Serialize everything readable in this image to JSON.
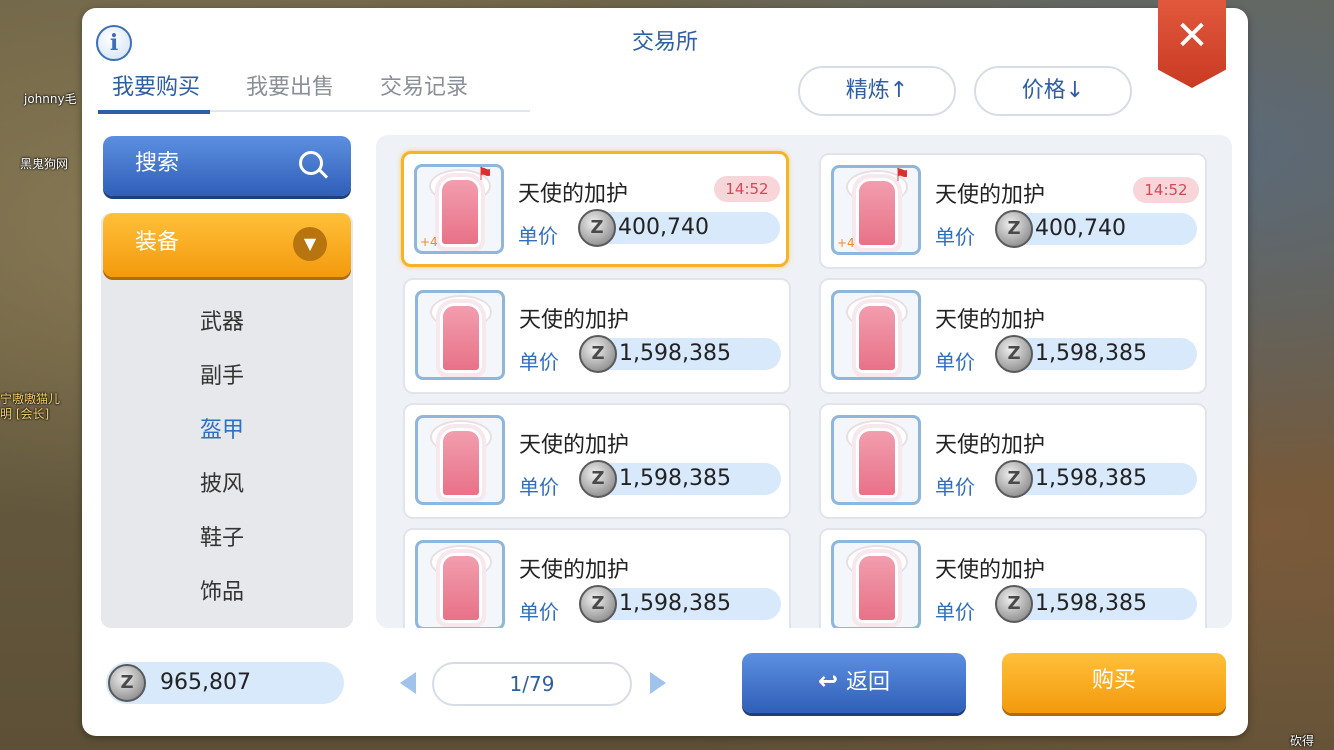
{
  "scene": {
    "labels": [
      "johnny毛",
      "黑鬼狗网",
      "宁嗷嗷猫儿",
      "明 [会长]",
      "砍得"
    ]
  },
  "window": {
    "title": "交易所",
    "info_icon": "i",
    "close_icon": "✕"
  },
  "tabs": [
    {
      "label": "我要购买",
      "active": true
    },
    {
      "label": "我要出售",
      "active": false
    },
    {
      "label": "交易记录",
      "active": false
    }
  ],
  "sort": {
    "refine_label": "精炼↑",
    "price_label": "价格↓"
  },
  "sidebar": {
    "search_label": "搜索",
    "category_label": "装备",
    "categories": [
      {
        "label": "武器",
        "active": false
      },
      {
        "label": "副手",
        "active": false
      },
      {
        "label": "盔甲",
        "active": true
      },
      {
        "label": "披风",
        "active": false
      },
      {
        "label": "鞋子",
        "active": false
      },
      {
        "label": "饰品",
        "active": false
      }
    ]
  },
  "wallet": {
    "balance": "965,807",
    "currency_icon": "Z"
  },
  "items": [
    {
      "name": "天使的加护",
      "price_label": "单价",
      "price": "400,740",
      "timer": "14:52",
      "refine": "+4",
      "selected": true
    },
    {
      "name": "天使的加护",
      "price_label": "单价",
      "price": "400,740",
      "timer": "14:52",
      "refine": "+4",
      "selected": false
    },
    {
      "name": "天使的加护",
      "price_label": "单价",
      "price": "1,598,385",
      "timer": "",
      "refine": "",
      "selected": false
    },
    {
      "name": "天使的加护",
      "price_label": "单价",
      "price": "1,598,385",
      "timer": "",
      "refine": "",
      "selected": false
    },
    {
      "name": "天使的加护",
      "price_label": "单价",
      "price": "1,598,385",
      "timer": "",
      "refine": "",
      "selected": false
    },
    {
      "name": "天使的加护",
      "price_label": "单价",
      "price": "1,598,385",
      "timer": "",
      "refine": "",
      "selected": false
    },
    {
      "name": "天使的加护",
      "price_label": "单价",
      "price": "1,598,385",
      "timer": "",
      "refine": "",
      "selected": false
    },
    {
      "name": "天使的加护",
      "price_label": "单价",
      "price": "1,598,385",
      "timer": "",
      "refine": "",
      "selected": false
    }
  ],
  "pagination": {
    "current": "1/79"
  },
  "actions": {
    "back_label": "返回",
    "back_icon": "↩",
    "buy_label": "购买"
  },
  "colors": {
    "accent_blue": "#2f5ea3",
    "button_orange": "#f39a0d",
    "close_red": "#c93a23",
    "selected_border": "#f5b428"
  }
}
